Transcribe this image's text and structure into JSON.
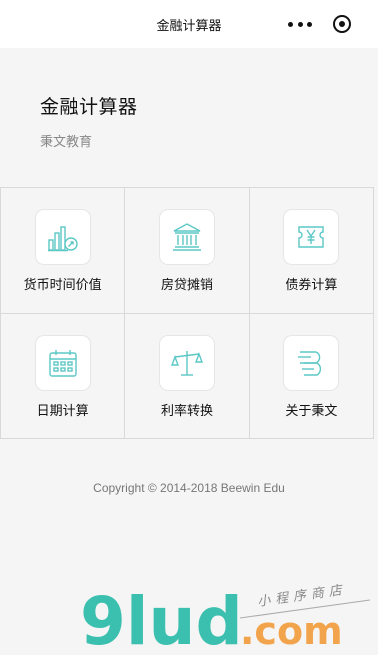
{
  "nav": {
    "title": "金融计算器",
    "more_icon": "more-dots-icon",
    "close_icon": "target-close-icon"
  },
  "header": {
    "title": "金融计算器",
    "subtitle": "秉文教育"
  },
  "accent": "#5cc8c6",
  "menu": [
    {
      "label": "货币时间价值",
      "icon": "bar-chart-growth-icon"
    },
    {
      "label": "房贷摊销",
      "icon": "bank-building-icon"
    },
    {
      "label": "债券计算",
      "icon": "yen-ticket-icon"
    },
    {
      "label": "日期计算",
      "icon": "calendar-icon"
    },
    {
      "label": "利率转换",
      "icon": "balance-scale-icon"
    },
    {
      "label": "关于秉文",
      "icon": "beewin-logo-icon"
    }
  ],
  "footer": {
    "copyright": "Copyright © 2014-2018 Beewin Edu"
  },
  "watermark": {
    "brand": "9lud",
    "domain": ".com",
    "tagline": "小程序商店"
  }
}
